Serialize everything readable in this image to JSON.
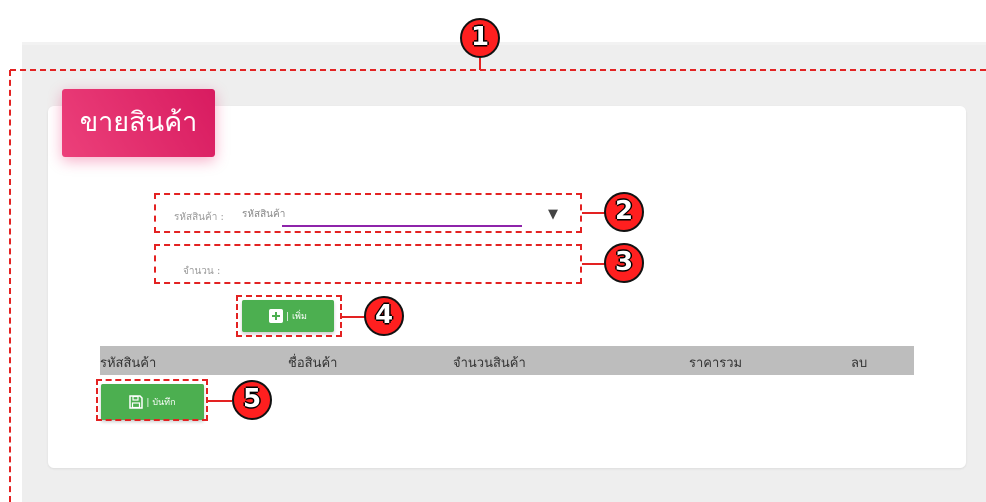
{
  "page": {
    "title": "ขายสินค้า"
  },
  "form": {
    "product_code_label": "รหัสสินค้า :",
    "product_code_value": "รหัสสินค้า",
    "quantity_label": "จำนวน :"
  },
  "buttons": {
    "add_label": "| เพิ่ม",
    "save_label": "| บันทึก"
  },
  "table": {
    "headers": [
      "รหัสสินค้า",
      "ชื่อสินค้า",
      "จำนวนสินค้า",
      "ราคารวม",
      "ลบ"
    ]
  },
  "callouts": [
    "1",
    "2",
    "3",
    "4",
    "5"
  ],
  "colors": {
    "accent": "#e91e63",
    "button": "#4caf50",
    "callout": "#ff1f1f",
    "underline": "#8e24aa"
  }
}
